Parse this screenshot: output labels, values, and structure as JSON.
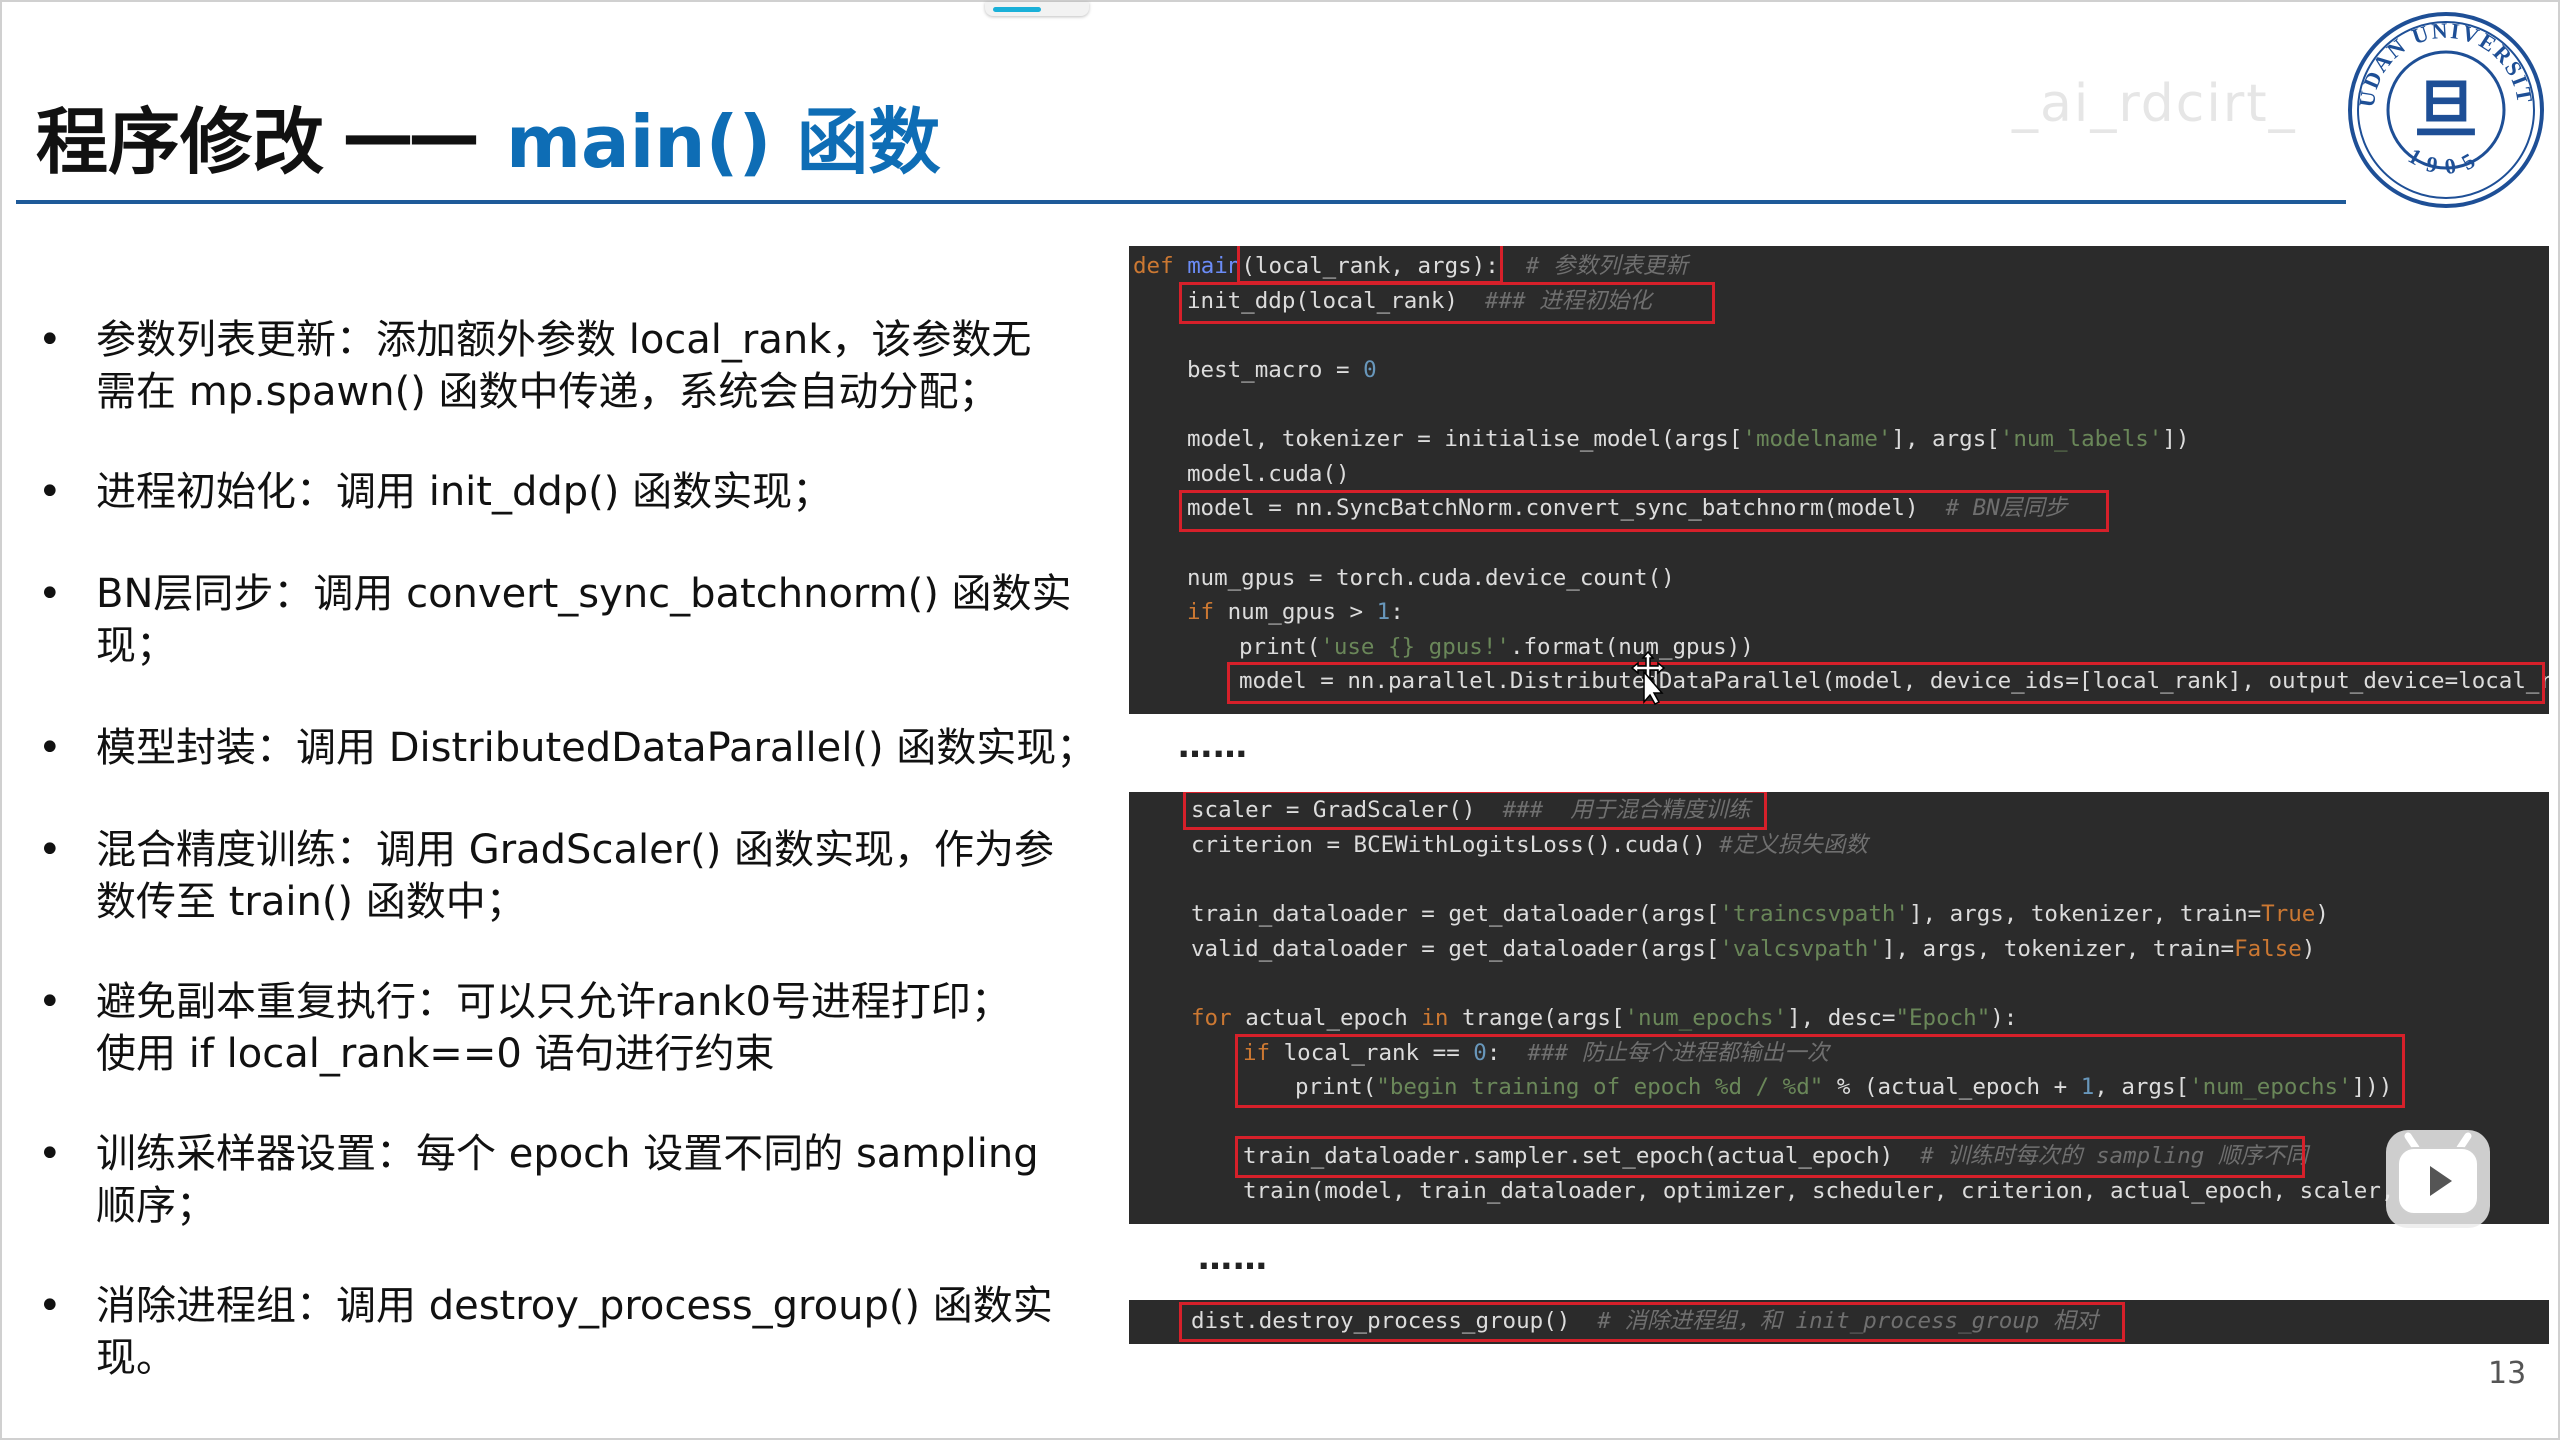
{
  "title": {
    "part1": "程序修改",
    "dash": "——",
    "part2": "main() 函数"
  },
  "logo": {
    "text_top": "FUDAN UNIVERSITY",
    "year": "1905",
    "center": "旦"
  },
  "watermark": "_ai_rdcirt_",
  "bullets": [
    {
      "lines": [
        "参数列表更新：添加额外参数 local_rank，该参数无",
        "需在 mp.spawn() 函数中传递，系统会自动分配；"
      ]
    },
    {
      "lines": [
        "进程初始化：调用 init_ddp() 函数实现；"
      ]
    },
    {
      "lines": [
        "BN层同步：调用 convert_sync_batchnorm() 函数实现；"
      ]
    },
    {
      "lines": [
        "模型封装：调用 DistributedDataParallel() 函数实现；"
      ]
    },
    {
      "lines": [
        "混合精度训练：调用 GradScaler() 函数实现，作为参",
        "数传至 train() 函数中；"
      ]
    },
    {
      "lines": [
        "避免副本重复执行：可以只允许rank0号进程打印；",
        "使用 if local_rank==0 语句进行约束"
      ]
    },
    {
      "lines": [
        "训练采样器设置：每个 epoch 设置不同的 sampling",
        "顺序；"
      ]
    },
    {
      "lines": [
        "消除进程组：调用 destroy_process_group() 函数实现。"
      ]
    }
  ],
  "bullet_symbol": "•",
  "ellipsis": "……",
  "code1": {
    "l1_kw": "def ",
    "l1_fn": "main",
    "l1_args": "(local_rank, args):",
    "l1_cm": "  # 参数列表更新",
    "l2_code": "init_ddp(local_rank)",
    "l2_cm": "  ### 进程初始化",
    "l3": "best_macro = ",
    "l3_num": "0",
    "l4a": "model, tokenizer = initialise_model(args[",
    "l4_s1": "'modelname'",
    "l4b": "], args[",
    "l4_s2": "'num_labels'",
    "l4c": "])",
    "l5": "model.cuda()",
    "l6_code": "model = nn.SyncBatchNorm.convert_sync_batchnorm(model)",
    "l6_cm": "  # BN层同步",
    "l7": "num_gpus = torch.cuda.device_count()",
    "l8_kw": "if ",
    "l8a": "num_gpus > ",
    "l8_num": "1",
    "l8b": ":",
    "l9a": "print(",
    "l9_s": "'use {} gpus!'",
    "l9b": ".format(num_gpus))",
    "l10": "model = nn.parallel.DistributedDataParallel(model, device_ids=[local_rank], output_device=local_ra"
  },
  "code2": {
    "l1_code": "scaler = GradScaler()",
    "l1_cm": "  ###  用于混合精度训练",
    "l2_code": "criterion = BCEWithLogitsLoss().cuda()",
    "l2_cm": " #定义损失函数",
    "l3a": "train_dataloader = get_dataloader(args[",
    "l3_s": "'traincsvpath'",
    "l3b": "], args, tokenizer, train=",
    "l3_t": "True",
    "l3c": ")",
    "l4a": "valid_dataloader = get_dataloader(args[",
    "l4_s": "'valcsvpath'",
    "l4b": "], args, tokenizer, train=",
    "l4_t": "False",
    "l4c": ")",
    "l5_kw": "for ",
    "l5a": "actual_epoch ",
    "l5_kw2": "in ",
    "l5b": "trange(args[",
    "l5_s": "'num_epochs'",
    "l5c": "], desc=",
    "l5_s2": "\"Epoch\"",
    "l5d": "):",
    "l6_kw": "if ",
    "l6a": "local_rank == ",
    "l6_num": "0",
    "l6b": ":",
    "l6_cm": "  ### 防止每个进程都输出一次",
    "l7a": "print(",
    "l7_s": "\"begin training of epoch %d / %d\"",
    "l7b": " % (actual_epoch + ",
    "l7_num": "1",
    "l7c": ", args[",
    "l7_s2": "'num_epochs'",
    "l7d": "]))",
    "l8_code": "train_dataloader.sampler.set_epoch(actual_epoch)",
    "l8_cm": "  # 训练时每次的 sampling 顺序不同",
    "l9": "train(model, train_dataloader, optimizer, scheduler, criterion, actual_epoch, scaler, args)"
  },
  "code3": {
    "l1_code": "dist.destroy_process_group()",
    "l1_cm": "  # 消除进程组，和 init_process_group 相对"
  },
  "page_number": "13",
  "colors": {
    "title_blue": "#0e6db5",
    "rule_blue": "#1e5a99",
    "code_bg": "#2b2b2b",
    "highlight_red": "#d6202a"
  },
  "icons": {
    "play": "play-icon",
    "cursor": "move-cursor-icon",
    "logo": "fudan-university-seal"
  }
}
